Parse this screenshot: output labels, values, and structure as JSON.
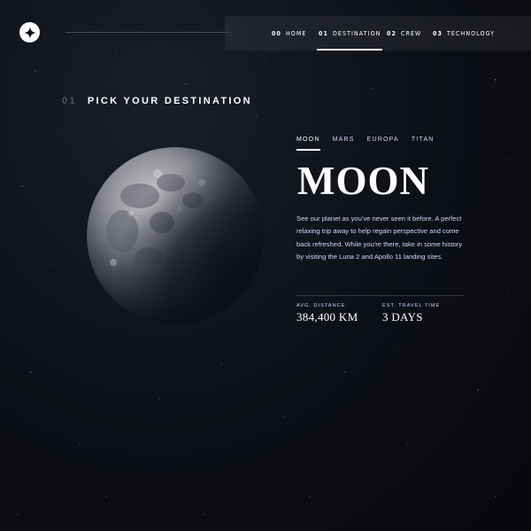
{
  "header": {
    "nav": [
      {
        "num": "00",
        "label": "HOME"
      },
      {
        "num": "01",
        "label": "DESTINATION"
      },
      {
        "num": "02",
        "label": "CREW"
      },
      {
        "num": "03",
        "label": "TECHNOLOGY"
      }
    ]
  },
  "page": {
    "number": "01",
    "title": "PICK YOUR DESTINATION"
  },
  "destination": {
    "tabs": [
      "MOON",
      "MARS",
      "EUROPA",
      "TITAN"
    ],
    "active_tab": "MOON",
    "name": "MOON",
    "description": "See our planet as you've never seen it before. A perfect relaxing trip away to help regain perspective and come back refreshed. While you're there, take in some history by visiting the Luna 2 and Apollo 11 landing sites.",
    "stats": {
      "distance_label": "AVG. DISTANCE",
      "distance_value": "384,400 KM",
      "travel_label": "EST. TRAVEL TIME",
      "travel_value": "3 DAYS"
    }
  },
  "icons": {
    "logo": "star-logo-icon",
    "planet": "moon-image"
  },
  "colors": {
    "background": "#0b0d17",
    "accent": "#d0d6f9",
    "white": "#ffffff"
  }
}
